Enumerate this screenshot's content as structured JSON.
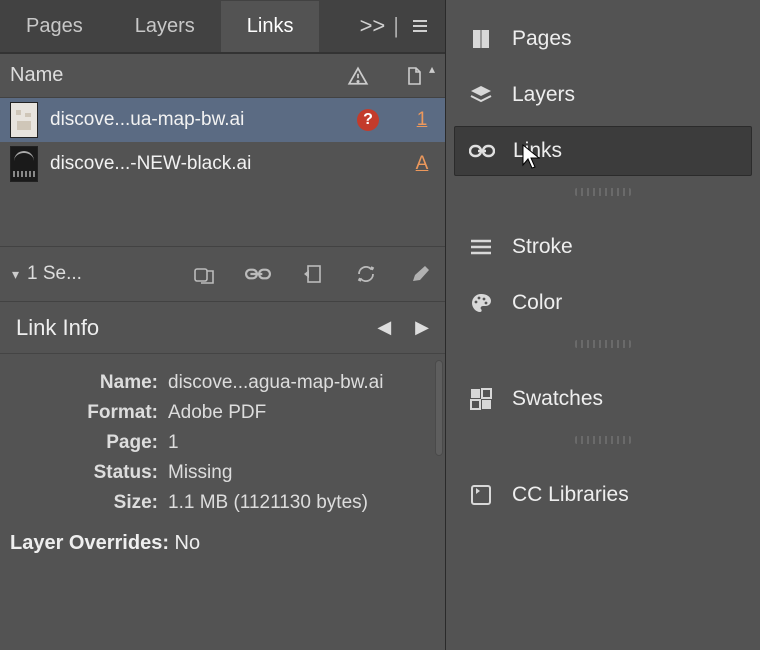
{
  "tabs": {
    "pages": "Pages",
    "layers": "Layers",
    "links": "Links",
    "overflow": ">>"
  },
  "columns": {
    "name": "Name"
  },
  "rows": [
    {
      "filename": "discove...ua-map-bw.ai",
      "missing": "?",
      "count": "1"
    },
    {
      "filename": "discove...-NEW-black.ai",
      "missing": "",
      "count": "A"
    }
  ],
  "selection": {
    "label": "1 Se..."
  },
  "linkInfo": {
    "heading": "Link Info",
    "name_k": "Name:",
    "name_v": "discove...agua-map-bw.ai",
    "format_k": "Format:",
    "format_v": "Adobe PDF",
    "page_k": "Page:",
    "page_v": "1",
    "status_k": "Status:",
    "status_v": "Missing",
    "size_k": "Size:",
    "size_v": "1.1 MB (1121130 bytes)",
    "layerov_k": "Layer Overrides:",
    "layerov_v": "No"
  },
  "sidePanel": {
    "pages": "Pages",
    "layers": "Layers",
    "links": "Links",
    "stroke": "Stroke",
    "color": "Color",
    "swatches": "Swatches",
    "cclibs": "CC Libraries"
  }
}
